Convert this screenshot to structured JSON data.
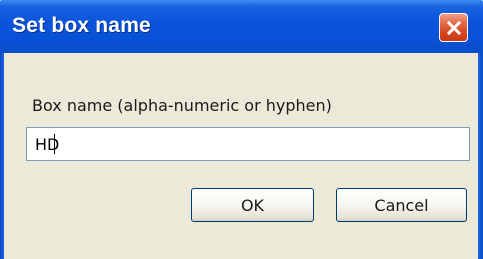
{
  "dialog": {
    "title": "Set box name",
    "close_icon": "close-icon"
  },
  "form": {
    "label": "Box name  (alpha-numeric or hyphen)",
    "value": "HD"
  },
  "buttons": {
    "ok_label": "OK",
    "cancel_label": "Cancel"
  },
  "colors": {
    "titlebar": "#0a55dc",
    "client_bg": "#ece9d8",
    "close_button": "#d4451f"
  }
}
